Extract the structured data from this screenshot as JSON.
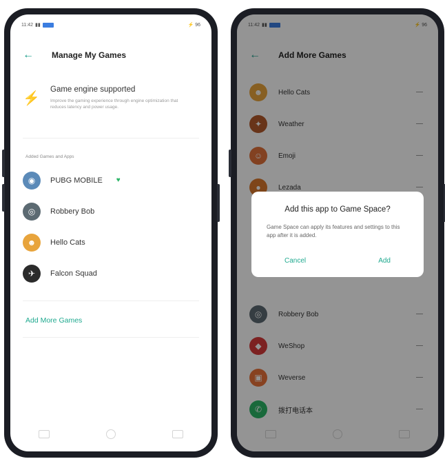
{
  "left_screen": {
    "status_bar": {
      "time": "11:42",
      "right": "⚡ 96"
    },
    "header": {
      "title": "Manage My Games"
    },
    "engine": {
      "title": "Game engine supported",
      "description": "Improve the gaming experience through engine optimization that reduces latency and power usage."
    },
    "section_label": "Added Games and Apps",
    "games": [
      {
        "name": "PUBG MOBILE",
        "supported": true
      },
      {
        "name": "Robbery Bob"
      },
      {
        "name": "Hello Cats"
      },
      {
        "name": "Falcon Squad"
      }
    ],
    "add_more_label": "Add More Games"
  },
  "right_screen": {
    "status_bar": {
      "time": "11:42",
      "right": "⚡ 96"
    },
    "header": {
      "title": "Add More Games"
    },
    "apps_top": [
      {
        "name": "Hello Cats"
      },
      {
        "name": "Weather"
      },
      {
        "name": "Emoji"
      },
      {
        "name": "Lezada"
      }
    ],
    "apps_bottom": [
      {
        "name": "Robbery Bob"
      },
      {
        "name": "WeShop"
      },
      {
        "name": "Weverse"
      },
      {
        "name": "拨打电话本"
      }
    ],
    "dialog": {
      "title": "Add this app to Game Space?",
      "message": "Game Space can apply its features and settings to this app after it is added.",
      "cancel_label": "Cancel",
      "add_label": "Add"
    }
  },
  "colors": {
    "accent": "#1fa98f",
    "leaf": "#2cb567",
    "dim": "rgba(0,0,0,0.42)"
  }
}
